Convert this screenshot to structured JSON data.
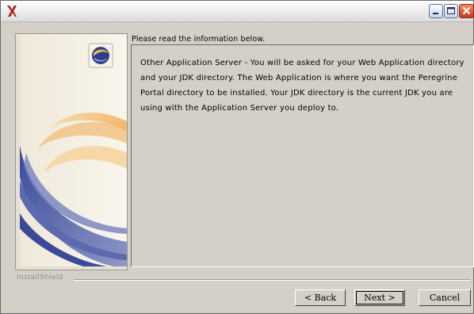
{
  "window": {
    "title": ""
  },
  "content": {
    "heading": "Please read the information below.",
    "info_text": "Other Application Server - You will be asked for your Web Application directory and your JDK directory. The Web Application is where you want the Peregrine Portal directory to be installed. Your JDK directory is the current JDK you are using with the Application Server you deploy to."
  },
  "footer": {
    "brand": "InstallShield"
  },
  "buttons": {
    "back_label": "< Back",
    "next_label": "Next >",
    "cancel_label": "Cancel"
  },
  "colors": {
    "window_bg": "#d4d0c8",
    "side_cream": "#f4efe2",
    "swirl_blue": "#4a5aa5",
    "swirl_orange": "#f0b060"
  }
}
